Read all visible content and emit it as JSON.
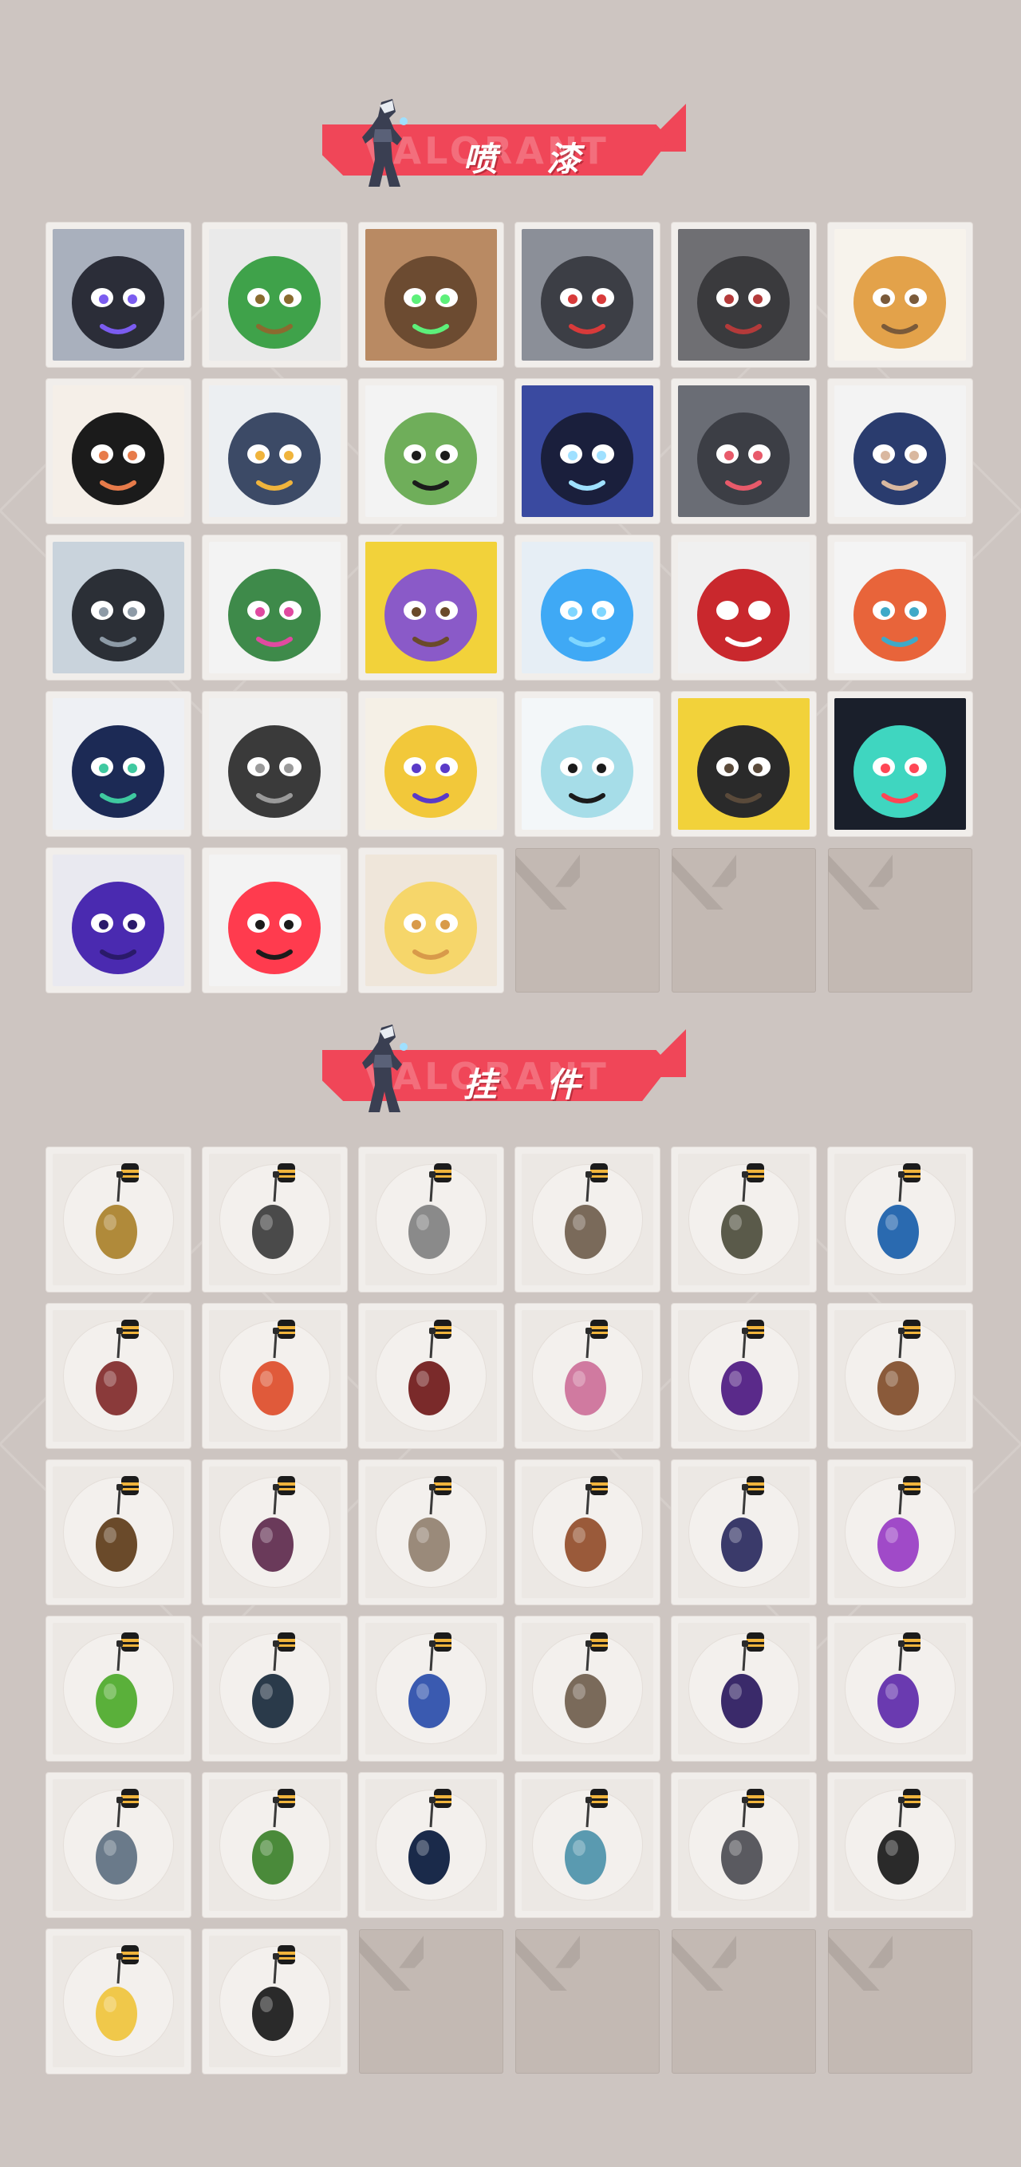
{
  "sections": {
    "sprays": {
      "title": "喷 漆"
    },
    "charms": {
      "title": "挂 件"
    }
  },
  "banner_ghost_text": "VALORANT",
  "colors": {
    "accent": "#f04658",
    "background": "#cdc5c1",
    "card": "#f1eeeb",
    "empty_slot": "#c3b9b3"
  },
  "sprays": [
    {
      "icon": "boy-purple-eyes-spray",
      "bg": "#a9b0bd",
      "fg": "#2b2d38",
      "accent": "#7b5cf0"
    },
    {
      "icon": "green-box-spray",
      "bg": "#eaeaea",
      "fg": "#3fa24a",
      "accent": "#8a6b2f"
    },
    {
      "icon": "green-eyed-creature-spray",
      "bg": "#b98a63",
      "fg": "#6c4b31",
      "accent": "#5df07a"
    },
    {
      "icon": "crying-rodent-spray",
      "bg": "#8b8f98",
      "fg": "#3c3e45",
      "accent": "#d83a3a"
    },
    {
      "icon": "cake-slice-spray",
      "bg": "#6f6f73",
      "fg": "#3a3a3d",
      "accent": "#b43a3a"
    },
    {
      "icon": "tiger-spray",
      "bg": "#f7f3ec",
      "fg": "#e3a24a",
      "accent": "#7a5a3a"
    },
    {
      "icon": "girl-pencil-spray",
      "bg": "#f5efe8",
      "fg": "#1b1b1b",
      "accent": "#e77b4a"
    },
    {
      "icon": "penguin-beanie-spray",
      "bg": "#eceff2",
      "fg": "#3c4a66",
      "accent": "#f0b43c"
    },
    {
      "icon": "frog-top-hat-spray",
      "bg": "#f3f3f3",
      "fg": "#6fae5a",
      "accent": "#1b1b1b"
    },
    {
      "icon": "smug-agent-spray",
      "bg": "#3a4aa0",
      "fg": "#1a1f3c",
      "accent": "#9fe0ff"
    },
    {
      "icon": "grinning-cat-spray",
      "bg": "#6a6d75",
      "fg": "#3c3e45",
      "accent": "#e85a6a"
    },
    {
      "icon": "hooded-agent-spray",
      "bg": "#f3f3f3",
      "fg": "#2a3c6e",
      "accent": "#d9b8a0"
    },
    {
      "icon": "pixel-sloth-spray",
      "bg": "#c9d3dc",
      "fg": "#2b2f36",
      "accent": "#8d9aa6"
    },
    {
      "icon": "laughing-girl-spray",
      "bg": "#f3f3f3",
      "fg": "#3e8a4a",
      "accent": "#e04aa0"
    },
    {
      "icon": "purple-banana-hat-spray",
      "bg": "#f2d23a",
      "fg": "#8a5ac8",
      "accent": "#6a4a2a"
    },
    {
      "icon": "neon-blue-spray",
      "bg": "#e6eef5",
      "fg": "#3fa9f5",
      "accent": "#7fd6ff"
    },
    {
      "icon": "red-x-button-spray",
      "bg": "#f0f0f0",
      "fg": "#c9282d",
      "accent": "#ffffff"
    },
    {
      "icon": "koi-fish-spray",
      "bg": "#f4f4f4",
      "fg": "#e8643a",
      "accent": "#3fa9c8"
    },
    {
      "icon": "agent-fan-spray",
      "bg": "#eef0f4",
      "fg": "#1c2a55",
      "accent": "#3fc9a0"
    },
    {
      "icon": "catfish-spray",
      "bg": "#f0f0f0",
      "fg": "#3a3a3a",
      "accent": "#9a9a9a"
    },
    {
      "icon": "flexing-agent-spray",
      "bg": "#f5f0e6",
      "fg": "#f2c83a",
      "accent": "#5a3ac8"
    },
    {
      "icon": "pouting-girl-spray",
      "bg": "#f3f7f9",
      "fg": "#a6dde8",
      "accent": "#1b1b1b"
    },
    {
      "icon": "pistol-creature-spray",
      "bg": "#f2d23a",
      "fg": "#2a2a2a",
      "accent": "#5a4a3a"
    },
    {
      "icon": "valorant-logo-teal-spray",
      "bg": "#1a1f2b",
      "fg": "#3fd6c0",
      "accent": "#ff4655"
    },
    {
      "icon": "purple-graffiti-spray",
      "bg": "#e9e9f0",
      "fg": "#4a2ab0",
      "accent": "#2a1a6a"
    },
    {
      "icon": "red-valorant-logo-spray",
      "bg": "#f3f3f3",
      "fg": "#ff3b4e",
      "accent": "#1b1b1b"
    },
    {
      "icon": "star-spray",
      "bg": "#efe6da",
      "fg": "#f6d66a",
      "accent": "#d89a4a"
    }
  ],
  "charms": [
    {
      "icon": "golden-cat-charm",
      "color": "#b08a3a"
    },
    {
      "icon": "robot-drone-charm",
      "color": "#4a4a4a"
    },
    {
      "icon": "toaster-charm",
      "color": "#8a8a8a"
    },
    {
      "icon": "astronaut-raccoon-charm",
      "color": "#7a6a5a"
    },
    {
      "icon": "canteen-charm",
      "color": "#5a5a4a"
    },
    {
      "icon": "energy-cell-charm",
      "color": "#2a6ab0"
    },
    {
      "icon": "chainsaw-blade-charm",
      "color": "#8a3a3a"
    },
    {
      "icon": "chili-pepper-charm",
      "color": "#e05a3a"
    },
    {
      "icon": "braided-cord-charm",
      "color": "#7a2a2a"
    },
    {
      "icon": "cupcake-charm",
      "color": "#d07aa0"
    },
    {
      "icon": "ep9-token-charm",
      "color": "#5a2a8a"
    },
    {
      "icon": "teddy-bear-bell-charm",
      "color": "#8a5a3a"
    },
    {
      "icon": "backpack-gadget-charm",
      "color": "#6a4a2a"
    },
    {
      "icon": "agent-figure-charm",
      "color": "#6a3a5a"
    },
    {
      "icon": "cowboy-bot-charm",
      "color": "#9a8a7a"
    },
    {
      "icon": "treasure-chest-charm",
      "color": "#9a5a3a"
    },
    {
      "icon": "wizard-figure-charm",
      "color": "#3a3a6a"
    },
    {
      "icon": "lava-lamp-charm",
      "color": "#a04ac8"
    },
    {
      "icon": "handheld-console-charm",
      "color": "#5ab03a"
    },
    {
      "icon": "sneaker-charm",
      "color": "#2a3a4a"
    },
    {
      "icon": "spaceman-charm",
      "color": "#3a5ab0"
    },
    {
      "icon": "radio-pack-charm",
      "color": "#7a6a5a"
    },
    {
      "icon": "ep9-token-charm-2",
      "color": "#3a2a6a"
    },
    {
      "icon": "pixel-heart-charm",
      "color": "#6a3ab0"
    },
    {
      "icon": "agent-keychain-charm",
      "color": "#6a7a8a"
    },
    {
      "icon": "soda-can-charm",
      "color": "#4a8a3a"
    },
    {
      "icon": "ep9-gold-token-charm",
      "color": "#1a2a4a"
    },
    {
      "icon": "ufo-charm",
      "color": "#5a9ab0"
    },
    {
      "icon": "cat-head-charm",
      "color": "#5a5a60"
    },
    {
      "icon": "valorant-medallion-charm",
      "color": "#2a2a2a"
    },
    {
      "icon": "egg-star-charm",
      "color": "#f0c84a"
    },
    {
      "icon": "diamond-tag-charm",
      "color": "#2a2a2a"
    }
  ],
  "empty_slot_icon": "valorant-logo-placeholder-icon"
}
